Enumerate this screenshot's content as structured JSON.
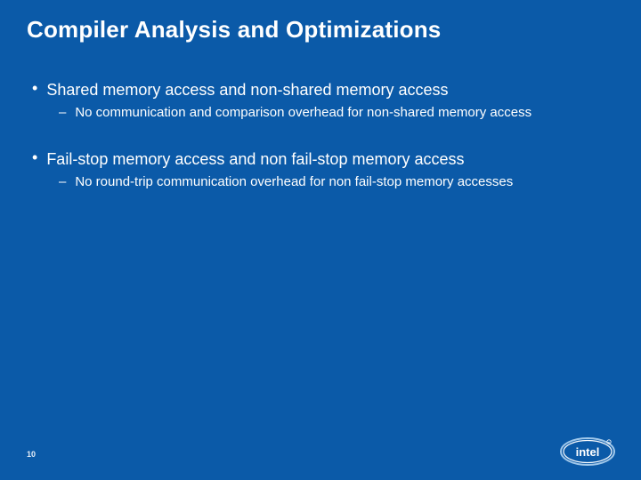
{
  "title": "Compiler Analysis and Optimizations",
  "bullets": [
    {
      "text": "Shared memory access and non-shared memory access",
      "sub": [
        "No communication and comparison overhead for non-shared memory access"
      ]
    },
    {
      "text": "Fail-stop memory access and non fail-stop memory access",
      "sub": [
        "No round-trip communication overhead for non fail-stop memory accesses"
      ]
    }
  ],
  "page_number": "10",
  "logo_name": "intel"
}
